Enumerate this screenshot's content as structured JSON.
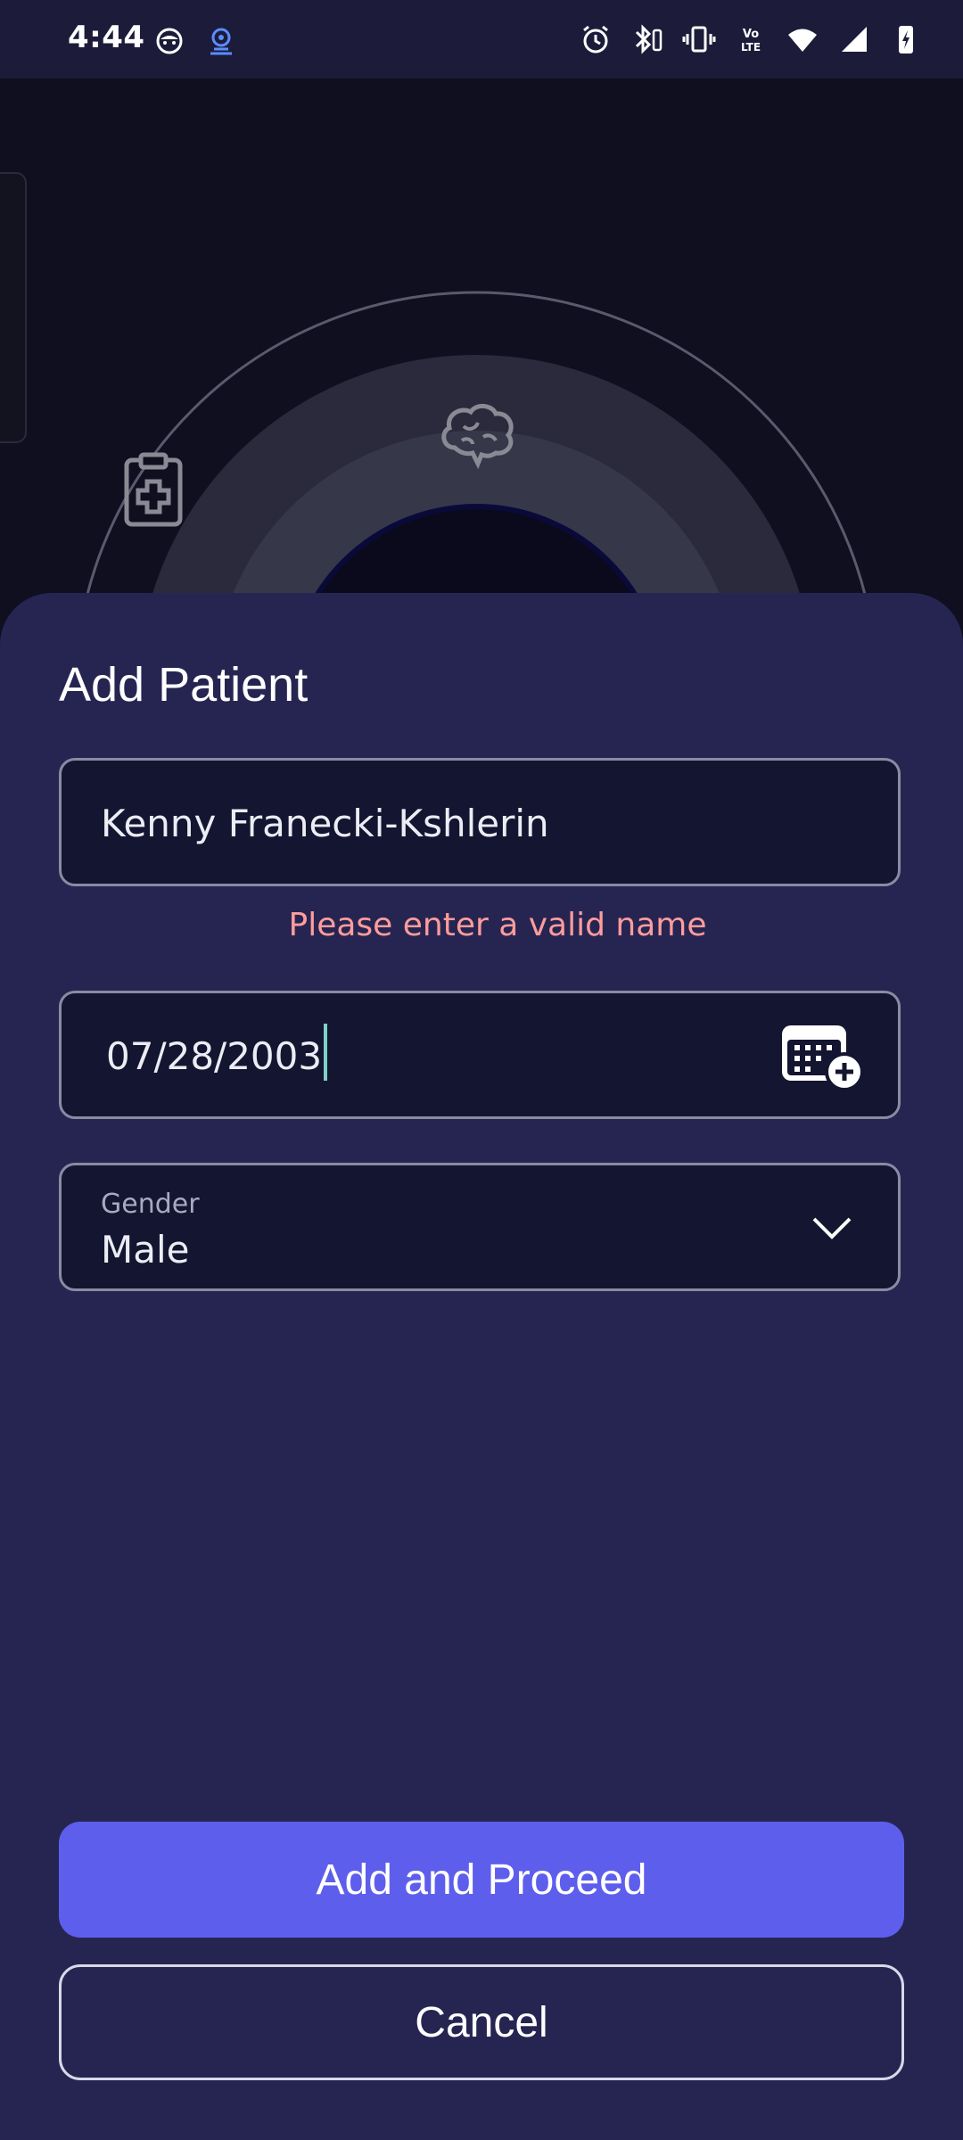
{
  "status_bar": {
    "time": "4:44",
    "left_icons": [
      "emoji-icon",
      "hotspot-icon"
    ],
    "right_icons": [
      "alarm-icon",
      "bluetooth-battery-icon",
      "vibrate-icon",
      "volte-icon",
      "wifi-icon",
      "signal-icon",
      "battery-charging-icon"
    ]
  },
  "background": {
    "icons": [
      "clipboard-medical-icon",
      "brain-icon"
    ]
  },
  "sheet": {
    "title": "Add Patient",
    "name_field": {
      "value": "Kenny Franecki-Kshlerin",
      "error": "Please enter a valid name"
    },
    "dob_field": {
      "value": "07/28/2003",
      "icon": "calendar-add-icon"
    },
    "gender_field": {
      "label": "Gender",
      "value": "Male",
      "icon": "chevron-down-icon"
    },
    "primary_button": "Add and Proceed",
    "secondary_button": "Cancel"
  },
  "colors": {
    "sheet_bg": "#262552",
    "field_bg": "#141530",
    "error": "#ff9c9c",
    "primary": "#5e5eed",
    "cursor": "#7fd0c8"
  }
}
